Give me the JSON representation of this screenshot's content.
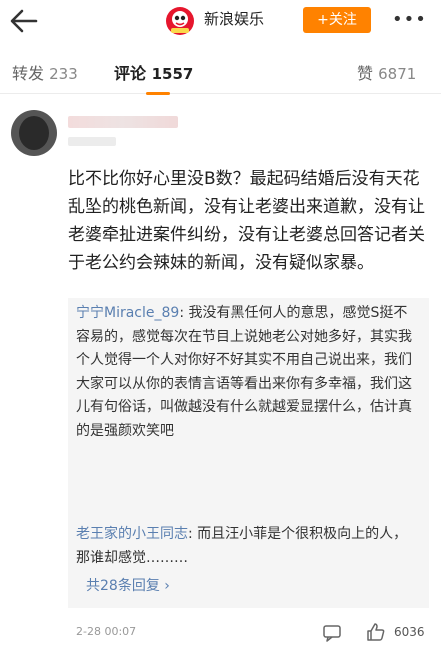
{
  "header": {
    "account_name": "新浪娱乐",
    "follow_label": "+关注",
    "more_label": "•••"
  },
  "tabs": {
    "repost_label": "转发",
    "repost_count": "233",
    "comment_label": "评论",
    "comment_count": "1557",
    "like_label": "赞",
    "like_count": "6871"
  },
  "comment": {
    "text": "比不比你好心里没B数？最起码结婚后没有天花乱坠的桃色新闻，没有让老婆出来道歉，没有让老婆牵扯进案件纠纷，没有让老婆总回答记者关于老公约会辣妹的新闻，没有疑似家暴。",
    "time": "2-28 00:07",
    "like_count": "6036"
  },
  "replies": [
    {
      "author": "宁宁Miracle_89",
      "text": ": 我没有黑任何人的意思，感觉S挺不容易的，感觉每次在节目上说她老公对她多好，其实我个人觉得一个人对你好不好其实不用自己说出来，我们大家可以从你的表情言语等看出来你有多幸福，我们这儿有句俗话，叫做越没有什么就越爱显摆什么，估计真的是强颜欢笑吧"
    },
    {
      "author": "老王家的小王同志",
      "text": ": 而且汪小菲是个很积极向上的人，那谁却感觉………"
    }
  ],
  "more_replies_label": "共28条回复 ›",
  "colors": {
    "accent": "#ff8200",
    "link": "#5a7fb0"
  }
}
